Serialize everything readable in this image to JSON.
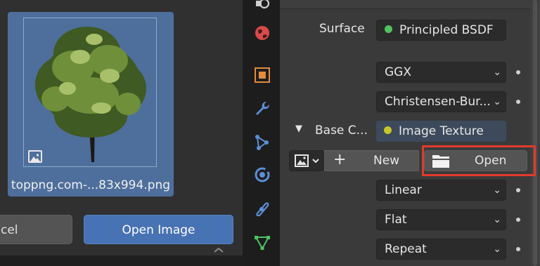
{
  "dialog": {
    "thumbnail": {
      "filename": "toppng.com-...83x994.png",
      "image_icon": "image-icon"
    },
    "cancel_label": "cel",
    "open_image_label": "Open Image",
    "collapse_icon": "chevron-up-icon"
  },
  "tabs": [
    {
      "name": "scene-tab",
      "icon": "scene-icon",
      "color": "#d0d0d0"
    },
    {
      "name": "world-tab",
      "icon": "world-icon",
      "color": "#e24d4d"
    },
    {
      "name": "object-tab",
      "icon": "object-icon",
      "color": "#e28c3c"
    },
    {
      "name": "modifier-tab",
      "icon": "wrench-icon",
      "color": "#5c8fd6"
    },
    {
      "name": "particles-tab",
      "icon": "particles-icon",
      "color": "#5c8fd6"
    },
    {
      "name": "physics-tab",
      "icon": "physics-icon",
      "color": "#5c8fd6"
    },
    {
      "name": "constraints-tab",
      "icon": "constraint-icon",
      "color": "#5c8fd6"
    },
    {
      "name": "data-tab",
      "icon": "mesh-data-icon",
      "color": "#4fc35f"
    }
  ],
  "properties": {
    "surface_label": "Surface",
    "surface_value": "Principled BSDF",
    "surface_socket_color": "#4fc35f",
    "distribution_value": "GGX",
    "subsurface_value": "Christensen-Bur...",
    "base_color_label": "Base C...",
    "base_color_value": "Image Texture",
    "base_color_socket_color": "#c7c729",
    "new_label": "New",
    "open_label": "Open",
    "interpolation_value": "Linear",
    "projection_value": "Flat",
    "extension_value": "Repeat",
    "highlight_color": "#e23b2b"
  }
}
